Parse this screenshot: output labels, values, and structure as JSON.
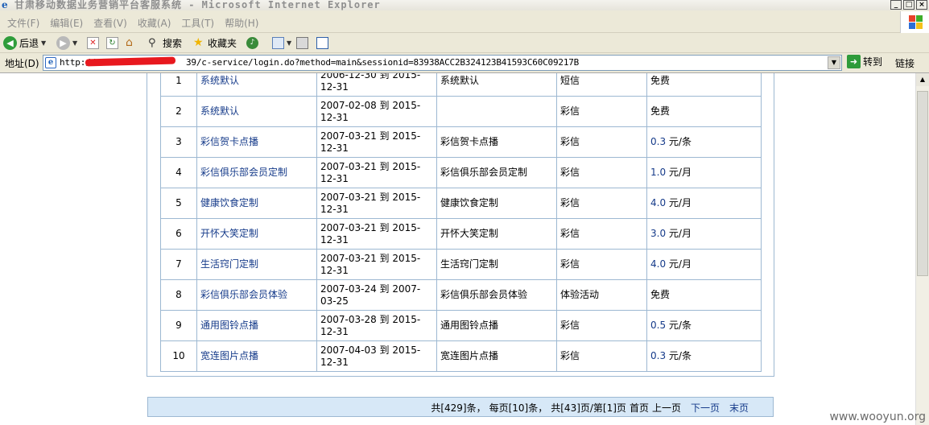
{
  "window": {
    "title": "甘肃移动数据业务营销平台客服系统 - Microsoft Internet Explorer",
    "buttons": [
      "_",
      "□",
      "×"
    ]
  },
  "menu": [
    "文件(F)",
    "编辑(E)",
    "查看(V)",
    "收藏(A)",
    "工具(T)",
    "帮助(H)"
  ],
  "toolbar": {
    "back": "后退",
    "search": "搜索",
    "favorites": "收藏夹"
  },
  "address": {
    "label": "地址(D)",
    "url_prefix": "http://",
    "url_suffix": "39/c-service/login.do?method=main&sessionid=83938ACC2B324123B41593C60C09217B",
    "go": "转到",
    "links": "链接"
  },
  "table": {
    "rows": [
      {
        "no": "1",
        "name": "系统默认",
        "date": "2006-12-30 到 2015-12-31",
        "desc": "系统默认",
        "type": "短信",
        "price_num": "",
        "price_unit": "免费"
      },
      {
        "no": "2",
        "name": "系统默认",
        "date": "2007-02-08 到 2015-12-31",
        "desc": "",
        "type": "彩信",
        "price_num": "",
        "price_unit": "免费"
      },
      {
        "no": "3",
        "name": "彩信贺卡点播",
        "date": "2007-03-21 到 2015-12-31",
        "desc": "彩信贺卡点播",
        "type": "彩信",
        "price_num": "0.3",
        "price_unit": "元/条"
      },
      {
        "no": "4",
        "name": "彩信俱乐部会员定制",
        "date": "2007-03-21 到 2015-12-31",
        "desc": "彩信俱乐部会员定制",
        "type": "彩信",
        "price_num": "1.0",
        "price_unit": "元/月"
      },
      {
        "no": "5",
        "name": "健康饮食定制",
        "date": "2007-03-21 到 2015-12-31",
        "desc": "健康饮食定制",
        "type": "彩信",
        "price_num": "4.0",
        "price_unit": "元/月"
      },
      {
        "no": "6",
        "name": "开怀大笑定制",
        "date": "2007-03-21 到 2015-12-31",
        "desc": "开怀大笑定制",
        "type": "彩信",
        "price_num": "3.0",
        "price_unit": "元/月"
      },
      {
        "no": "7",
        "name": "生活窍门定制",
        "date": "2007-03-21 到 2015-12-31",
        "desc": "生活窍门定制",
        "type": "彩信",
        "price_num": "4.0",
        "price_unit": "元/月"
      },
      {
        "no": "8",
        "name": "彩信俱乐部会员体验",
        "date": "2007-03-24 到 2007-03-25",
        "desc": "彩信俱乐部会员体验",
        "type": "体验活动",
        "price_num": "",
        "price_unit": "免费"
      },
      {
        "no": "9",
        "name": "通用图铃点播",
        "date": "2007-03-28 到 2015-12-31",
        "desc": "通用图铃点播",
        "type": "彩信",
        "price_num": "0.5",
        "price_unit": "元/条"
      },
      {
        "no": "10",
        "name": "宽连图片点播",
        "date": "2007-04-03 到 2015-12-31",
        "desc": "宽连图片点播",
        "type": "彩信",
        "price_num": "0.3",
        "price_unit": "元/条"
      }
    ]
  },
  "pager": {
    "total": "共[429]条，",
    "per_page": "每页[10]条，",
    "pages": "共[43]页/第[1]页",
    "first": "首页",
    "prev": "上一页",
    "next": "下一页",
    "last": "末页"
  },
  "watermark": "www.wooyun.org",
  "colors": {
    "link": "#163b8a",
    "border": "#9db8d2",
    "pager_bg": "#d7e8f7",
    "chrome": "#ece9d8"
  }
}
